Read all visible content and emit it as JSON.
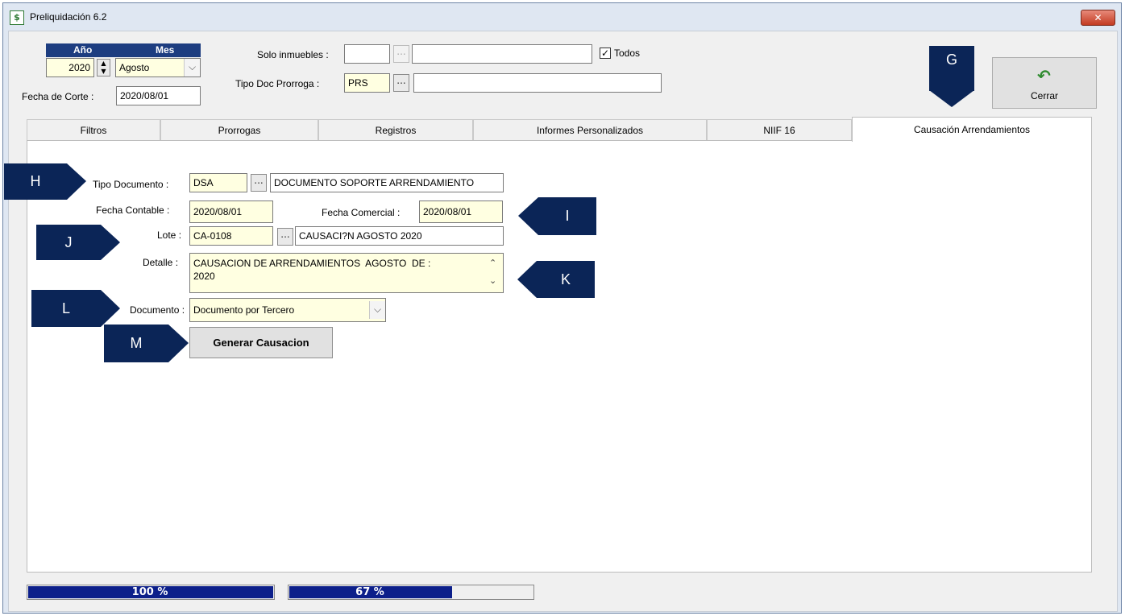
{
  "window": {
    "title": "Preliquidación 6.2",
    "close_symbol": "✕"
  },
  "header": {
    "year_label": "Año",
    "month_label": "Mes",
    "year_value": "2020",
    "month_value": "Agosto",
    "fecha_corte_label": "Fecha de Corte :",
    "fecha_corte_value": "2020/08/01",
    "solo_inmuebles_label": "Solo inmuebles :",
    "solo_inmuebles_code": "",
    "solo_inmuebles_desc": "",
    "todos_label": "Todos",
    "todos_checked": true,
    "tipo_doc_prorroga_label": "Tipo Doc Prorroga :",
    "tipo_doc_prorroga_code": "PRS",
    "tipo_doc_prorroga_desc": "",
    "browse_label": "..."
  },
  "toolbar": {
    "cerrar_label": "Cerrar",
    "cerrar_icon": "undo-arrow-icon"
  },
  "tabs": [
    {
      "label": "Filtros",
      "active": false
    },
    {
      "label": "Prorrogas",
      "active": false
    },
    {
      "label": "Registros",
      "active": false
    },
    {
      "label": "Informes Personalizados",
      "active": false
    },
    {
      "label": "NIIF 16",
      "active": false
    },
    {
      "label": "Causación Arrendamientos",
      "active": true
    }
  ],
  "form": {
    "tipo_documento_label": "Tipo Documento :",
    "tipo_documento_code": "DSA",
    "tipo_documento_desc": "DOCUMENTO SOPORTE ARRENDAMIENTO",
    "fecha_contable_label": "Fecha Contable :",
    "fecha_contable_value": "2020/08/01",
    "fecha_comercial_label": "Fecha Comercial :",
    "fecha_comercial_value": "2020/08/01",
    "lote_label": "Lote :",
    "lote_code": "CA-0108",
    "lote_desc": "CAUSACI?N AGOSTO 2020",
    "detalle_label": "Detalle :",
    "detalle_value": "CAUSACION DE ARRENDAMIENTOS  AGOSTO  DE :\n2020",
    "documento_label": "Documento :",
    "documento_value": "Documento por Tercero",
    "generar_label": "Generar Causacion"
  },
  "callouts": [
    "G",
    "H",
    "I",
    "J",
    "K",
    "L",
    "M"
  ],
  "status": {
    "progress1": {
      "text": "100 %",
      "value": 1.0
    },
    "progress2": {
      "text": "67 %",
      "value": 0.67
    }
  },
  "colors": {
    "callout": "#0b2557",
    "progress_fill": "#0c1f8a",
    "input_highlight": "#ffffe1"
  }
}
